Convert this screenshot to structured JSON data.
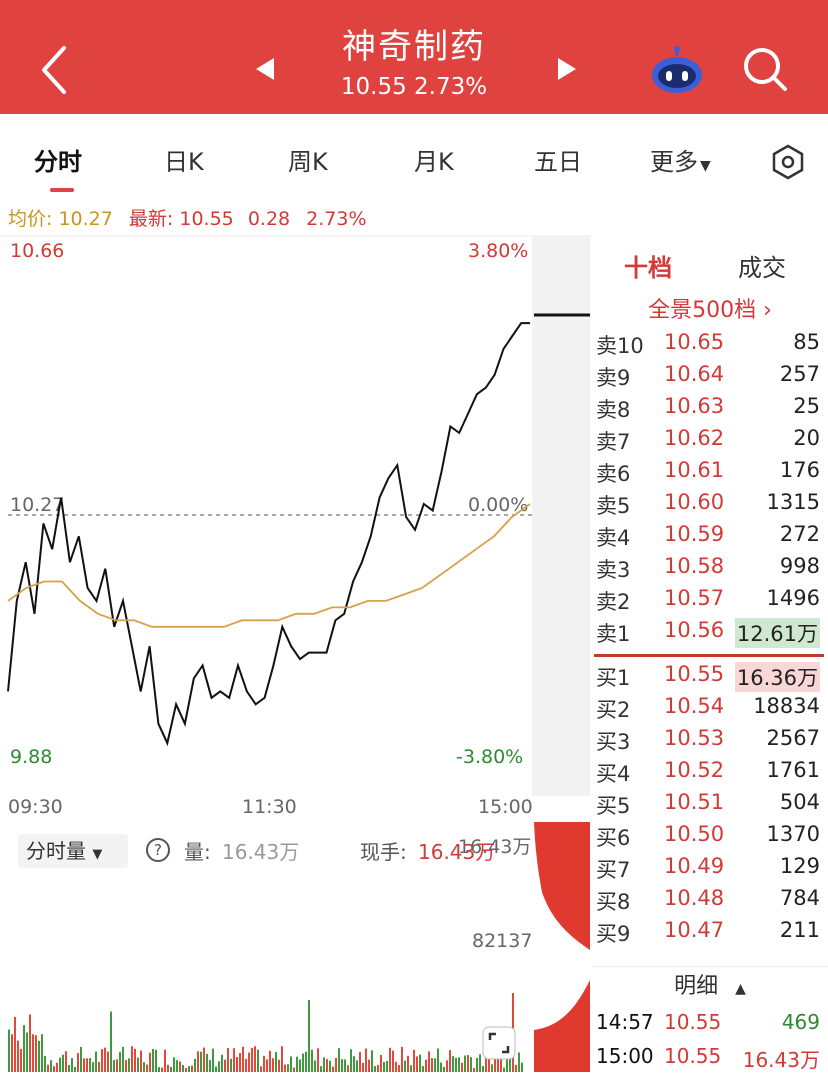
{
  "header": {
    "title": "神奇制药",
    "subtitle": "10.55 2.73%",
    "back_icon": "chevron-left-icon",
    "prev_icon": "triangle-left-icon",
    "next_icon": "triangle-right-icon",
    "robot_icon": "robot-assistant-icon",
    "search_icon": "search-icon",
    "colors": {
      "bar": "#e0423f",
      "text": "#ffffff"
    }
  },
  "tabs": [
    {
      "label": "分时",
      "active": true
    },
    {
      "label": "日K"
    },
    {
      "label": "周K"
    },
    {
      "label": "月K"
    },
    {
      "label": "五日"
    },
    {
      "label": "更多"
    }
  ],
  "settings_icon": "hexagon-settings-icon",
  "info": {
    "avg_label": "均价:",
    "avg_value": "10.27",
    "latest_label": "最新:",
    "latest_value": "10.55",
    "change": "0.28",
    "change_pct": "2.73%"
  },
  "chart_labels": {
    "top_left": "10.66",
    "top_right": "3.80%",
    "mid_left": "10.27",
    "mid_right": "0.00%",
    "bottom_left": "9.88",
    "bottom_right": "-3.80%",
    "time_start": "09:30",
    "time_mid": "11:30",
    "time_end": "15:00"
  },
  "chart_data": {
    "type": "line",
    "ylim": [
      9.88,
      10.66
    ],
    "prev_close": 10.27,
    "series": [
      {
        "values": [
          9.98,
          10.12,
          10.18,
          10.1,
          10.24,
          10.2,
          10.28,
          10.18,
          10.22,
          10.14,
          10.12,
          10.17,
          10.08,
          10.12,
          10.05,
          9.98,
          10.05,
          9.93,
          9.9,
          9.96,
          9.93,
          10.0,
          10.02,
          9.97,
          9.98,
          9.97,
          10.02,
          9.98,
          9.96,
          9.97,
          10.02,
          10.08,
          10.05,
          10.03,
          10.04,
          10.04,
          10.04,
          10.09,
          10.1,
          10.15,
          10.18,
          10.22,
          10.28,
          10.31,
          10.33,
          10.25,
          10.23,
          10.27,
          10.26,
          10.32,
          10.39,
          10.38,
          10.41,
          10.44,
          10.45,
          10.47,
          10.51,
          10.53,
          10.55,
          10.55
        ]
      },
      {
        "name": "均价",
        "values": [
          10.12,
          10.14,
          10.15,
          10.15,
          10.12,
          10.1,
          10.09,
          10.09,
          10.08,
          10.08,
          10.08,
          10.08,
          10.08,
          10.09,
          10.09,
          10.09,
          10.1,
          10.1,
          10.11,
          10.11,
          10.12,
          10.12,
          10.13,
          10.14,
          10.16,
          10.18,
          10.2,
          10.22,
          10.25,
          10.27
        ]
      }
    ]
  },
  "volume": {
    "selector_label": "分时量",
    "help_icon": "question-circle-icon",
    "amount_label": "量:",
    "amount_value": "16.43万",
    "current_label": "现手:",
    "current_value": "16.43万",
    "axis_top": "16.43万",
    "axis_mid": "82137",
    "fullscreen_icon": "fullscreen-icon"
  },
  "orderbook": {
    "tab_active": "十档",
    "tab_other": "成交",
    "panorama": "全景500档 ›",
    "asks": [
      {
        "side": "卖10",
        "price": "10.65",
        "vol": "85"
      },
      {
        "side": "卖9",
        "price": "10.64",
        "vol": "257"
      },
      {
        "side": "卖8",
        "price": "10.63",
        "vol": "25"
      },
      {
        "side": "卖7",
        "price": "10.62",
        "vol": "20"
      },
      {
        "side": "卖6",
        "price": "10.61",
        "vol": "176"
      },
      {
        "side": "卖5",
        "price": "10.60",
        "vol": "1315"
      },
      {
        "side": "卖4",
        "price": "10.59",
        "vol": "272"
      },
      {
        "side": "卖3",
        "price": "10.58",
        "vol": "998"
      },
      {
        "side": "卖2",
        "price": "10.57",
        "vol": "1496"
      },
      {
        "side": "卖1",
        "price": "10.56",
        "vol": "12.61万"
      }
    ],
    "bids": [
      {
        "side": "买1",
        "price": "10.55",
        "vol": "16.36万"
      },
      {
        "side": "买2",
        "price": "10.54",
        "vol": "18834"
      },
      {
        "side": "买3",
        "price": "10.53",
        "vol": "2567"
      },
      {
        "side": "买4",
        "price": "10.52",
        "vol": "1761"
      },
      {
        "side": "买5",
        "price": "10.51",
        "vol": "504"
      },
      {
        "side": "买6",
        "price": "10.50",
        "vol": "1370"
      },
      {
        "side": "买7",
        "price": "10.49",
        "vol": "129"
      },
      {
        "side": "买8",
        "price": "10.48",
        "vol": "784"
      },
      {
        "side": "买9",
        "price": "10.47",
        "vol": "211"
      }
    ],
    "detail_label": "明细",
    "detail_icon": "triangle-up-icon",
    "trades": [
      {
        "time": "14:57",
        "price": "10.55",
        "vol": "469"
      },
      {
        "time": "15:00",
        "price": "10.55",
        "vol": "16.43万"
      }
    ]
  }
}
